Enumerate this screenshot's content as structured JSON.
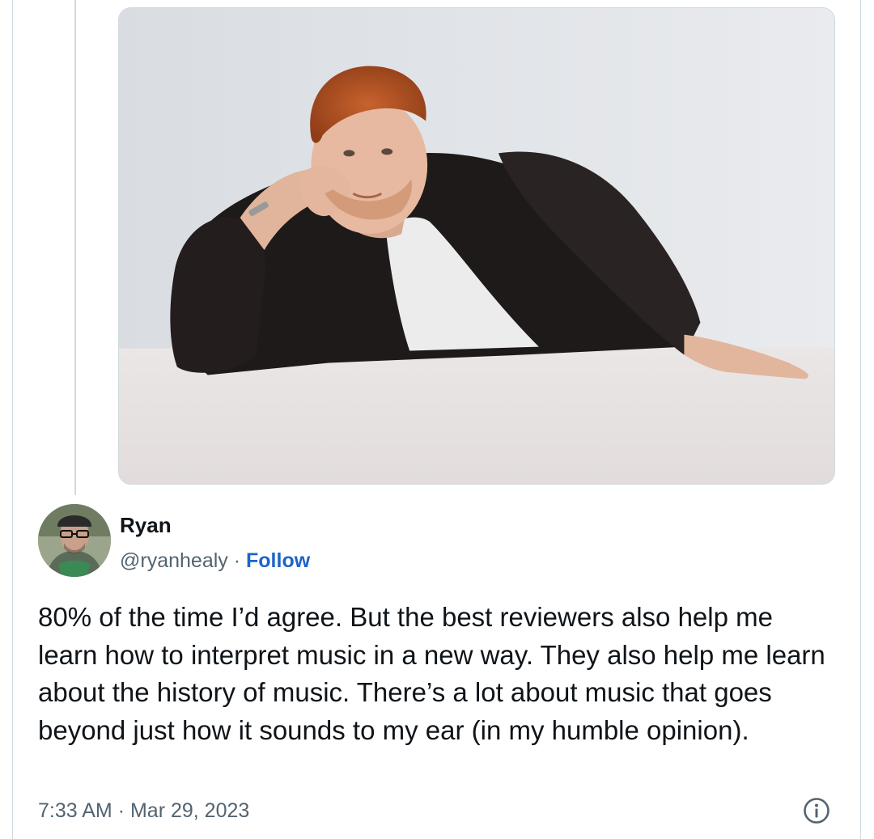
{
  "tweet": {
    "author": {
      "name": "Ryan",
      "handle": "@ryanhealy",
      "separator": "·",
      "follow_label": "Follow"
    },
    "text": "80% of the time I’d agree. But the best reviewers also help me learn how to interpret music in a new way. They also help me learn about the history of music. There’s a lot about music that goes beyond just how it sounds to my ear (in my humble opinion).",
    "timestamp": {
      "time": "7:33 AM",
      "separator": "·",
      "date": "Mar 29, 2023"
    },
    "icons": {
      "info": "info-icon"
    }
  },
  "colors": {
    "accent": "#1d64c9",
    "text_primary": "#0f1419",
    "text_secondary": "#536471",
    "border": "#cfd9de"
  }
}
